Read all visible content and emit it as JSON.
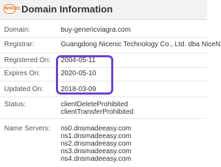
{
  "header": {
    "logo_text": "WHOIS",
    "title": "Domain Information"
  },
  "fields": {
    "domain": {
      "label": "Domain:",
      "value": "buy-genericviagra.com"
    },
    "registrar": {
      "label": "Registrar:",
      "value": "Guangdong Nicenic Technology Co., Ltd. dba NiceNIC"
    },
    "registered_on": {
      "label": "Registered On:",
      "value": "2004-05-11"
    },
    "expires_on": {
      "label": "Expires On:",
      "value": "2020-05-10"
    },
    "updated_on": {
      "label": "Updated On:",
      "value": "2018-03-09"
    },
    "status": {
      "label": "Status:",
      "values": [
        "clientDeleteProhibited",
        "clientTransferProhibited"
      ]
    },
    "name_servers": {
      "label": "Name Servers:",
      "values": [
        "ns0.dnsmadeeasy.com",
        "ns1.dnsmadeeasy.com",
        "ns2.dnsmadeeasy.com",
        "ns3.dnsmadeeasy.com",
        "ns4.dnsmadeeasy.com"
      ]
    }
  },
  "colors": {
    "highlight": "#6b3fcf",
    "logo": "#e8873a"
  }
}
